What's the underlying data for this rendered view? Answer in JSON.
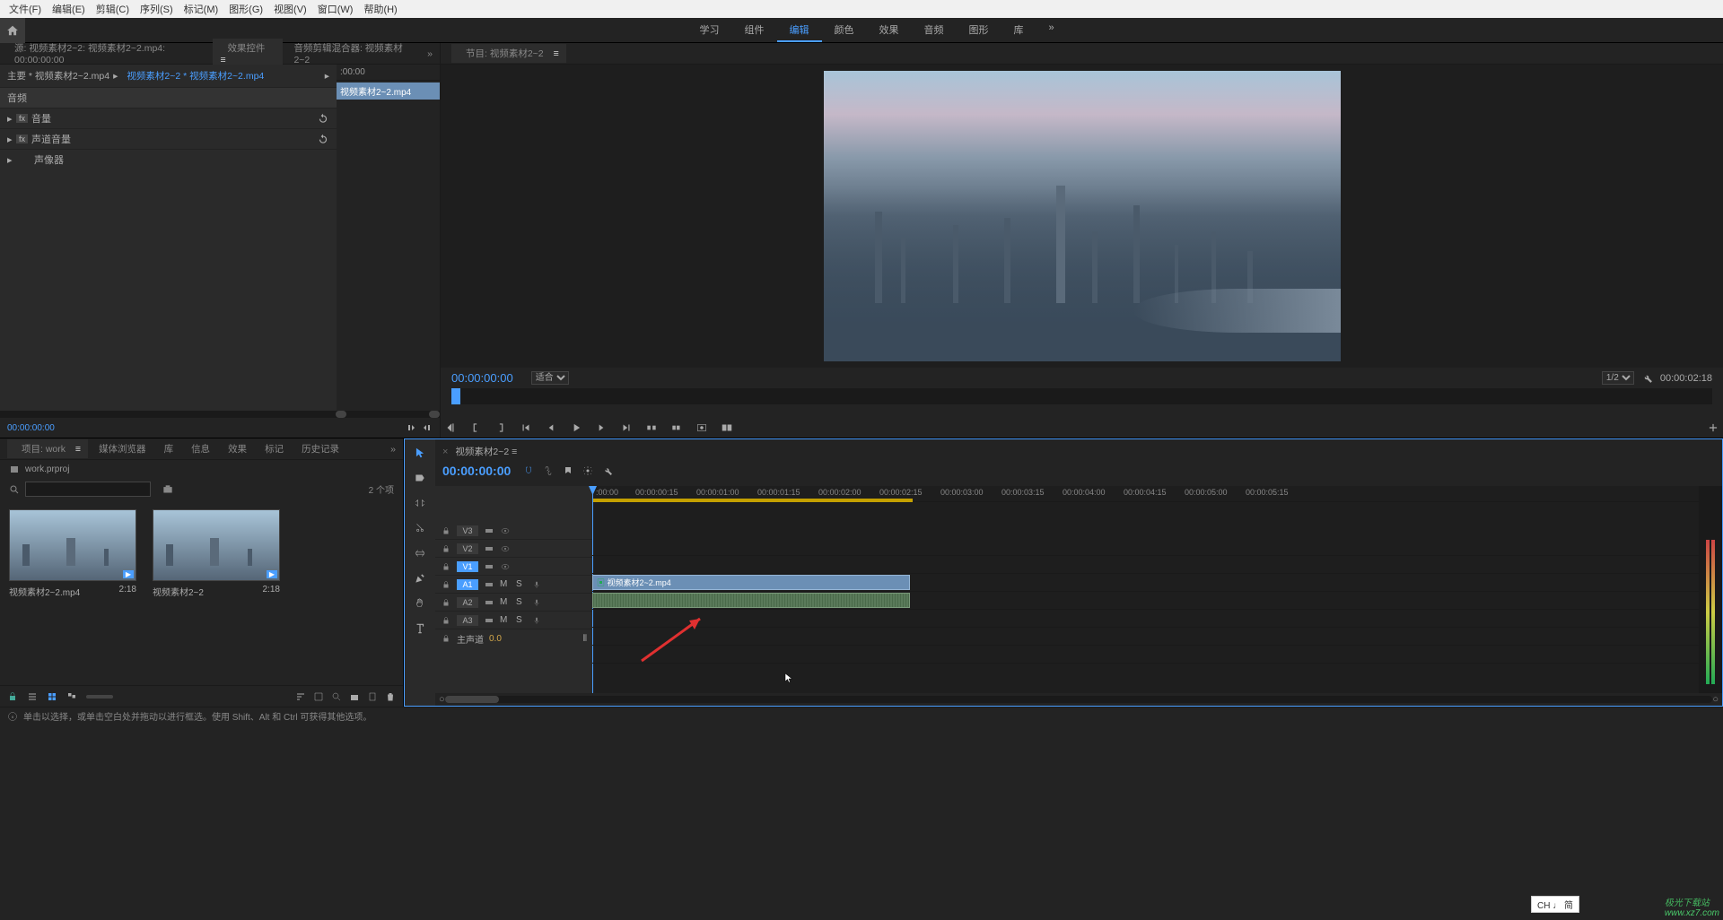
{
  "menubar": [
    "文件(F)",
    "编辑(E)",
    "剪辑(C)",
    "序列(S)",
    "标记(M)",
    "图形(G)",
    "视图(V)",
    "窗口(W)",
    "帮助(H)"
  ],
  "workspaces": {
    "items": [
      "学习",
      "组件",
      "编辑",
      "颜色",
      "效果",
      "音频",
      "图形",
      "库"
    ],
    "active_index": 2,
    "more": "»"
  },
  "source_panel": {
    "tabs": {
      "source": "源: 视频素材2~2: 视频素材2~2.mp4: 00:00:00:00",
      "effect_controls": "效果控件",
      "audio_mixer": "音频剪辑混合器: 视频素材2~2",
      "more": "»"
    },
    "clip_path": {
      "first": "主要 * 视频素材2~2.mp4",
      "second": "视频素材2~2 * 视频素材2~2.mp4"
    },
    "effect_rows": {
      "audio_header": "音频",
      "volume": "音量",
      "channel_volume": "声道音量",
      "panner": "声像器"
    },
    "timeline_header": ":00:00",
    "timeline_clip": "视频素材2~2.mp4",
    "timecode": "00:00:00:00"
  },
  "program_panel": {
    "tab": "节目: 视频素材2~2",
    "timecode": "00:00:00:00",
    "fit_label": "适合",
    "scale": "1/2",
    "duration": "00:00:02:18"
  },
  "project_panel": {
    "tabs": {
      "project": "项目: work",
      "media_browser": "媒体浏览器",
      "libraries": "库",
      "info": "信息",
      "effects": "效果",
      "markers": "标记",
      "history": "历史记录",
      "more": "»"
    },
    "project_name": "work.prproj",
    "search_placeholder": "",
    "item_count": "2 个项",
    "thumbs": [
      {
        "name": "视频素材2~2.mp4",
        "duration": "2:18"
      },
      {
        "name": "视频素材2~2",
        "duration": "2:18"
      }
    ]
  },
  "timeline": {
    "tab": "视频素材2~2",
    "timecode": "00:00:00:00",
    "ruler_marks": [
      ":00:00",
      "00:00:00:15",
      "00:00:01:00",
      "00:00:01:15",
      "00:00:02:00",
      "00:00:02:15",
      "00:00:03:00",
      "00:00:03:15",
      "00:00:04:00",
      "00:00:04:15",
      "00:00:05:00",
      "00:00:05:15"
    ],
    "video_tracks": [
      {
        "name": "V3",
        "target": false
      },
      {
        "name": "V2",
        "target": false
      },
      {
        "name": "V1",
        "target": true
      }
    ],
    "audio_tracks": [
      {
        "name": "A1",
        "target": true,
        "mute": "M",
        "solo": "S"
      },
      {
        "name": "A2",
        "target": false,
        "mute": "M",
        "solo": "S"
      },
      {
        "name": "A3",
        "target": false,
        "mute": "M",
        "solo": "S"
      }
    ],
    "master": {
      "label": "主声道",
      "db": "0.0"
    },
    "clip_name": "视频素材2~2.mp4"
  },
  "statusbar": {
    "hint": "单击以选择，或单击空白处并拖动以进行框选。使用 Shift、Alt 和 Ctrl 可获得其他选项。"
  },
  "ime": "CH ♩ 简",
  "watermark": {
    "cn": "极光下载站",
    "url": "www.xz7.com"
  }
}
